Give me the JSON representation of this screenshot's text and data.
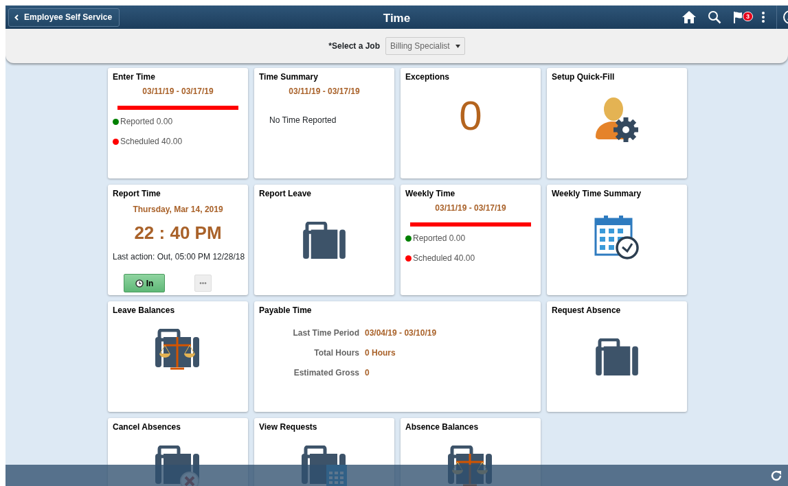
{
  "header": {
    "back_button": "Employee Self Service",
    "title": "Time",
    "notification_count": "3"
  },
  "job_selector": {
    "label": "*Select a Job",
    "value": "Billing Specialist"
  },
  "tiles": [
    {
      "kind": "period",
      "title": "Enter Time",
      "period": "03/11/19 - 03/17/19",
      "level": 1,
      "legend": [
        {
          "label": "Reported 0.00",
          "color": "#008000"
        },
        {
          "label": "Scheduled 40.00",
          "color": "#ff0000"
        }
      ]
    },
    {
      "kind": "summary",
      "title": "Time Summary",
      "period": "03/11/19 - 03/17/19",
      "message": "No Time Reported"
    },
    {
      "kind": "count",
      "title": "Exceptions",
      "count": "0"
    },
    {
      "kind": "quickfill",
      "title": "Setup Quick-Fill"
    },
    {
      "kind": "clock",
      "title": "Report Time",
      "date": "Thursday, Mar 14, 2019",
      "time": "22 : 40 PM",
      "last_action": "Last action: Out, 05:00 PM 12/28/18",
      "in_button": "In",
      "more_button": "•••"
    },
    {
      "kind": "leave",
      "title": "Report Leave"
    },
    {
      "kind": "period",
      "title": "Weekly Time",
      "period": "03/11/19 - 03/17/19",
      "level": 1,
      "legend": [
        {
          "label": "Reported 0.00",
          "color": "#008000"
        },
        {
          "label": "Scheduled 40.00",
          "color": "#ff0000"
        }
      ]
    },
    {
      "kind": "weekly-summary",
      "title": "Weekly Time Summary"
    },
    {
      "kind": "balances",
      "title": "Leave Balances"
    },
    {
      "kind": "payable",
      "title": "Payable Time",
      "rows": [
        {
          "label": "Last Time Period",
          "value": "03/04/19 - 03/10/19"
        },
        {
          "label": "Total Hours",
          "value": "0 Hours"
        },
        {
          "label": "Estimated Gross",
          "value": "0"
        }
      ]
    },
    {
      "kind": "leave",
      "title": "Request Absence"
    },
    {
      "kind": "cancel",
      "title": "Cancel Absences"
    },
    {
      "kind": "requests",
      "title": "View Requests"
    },
    {
      "kind": "balances",
      "title": "Absence Balances"
    }
  ]
}
